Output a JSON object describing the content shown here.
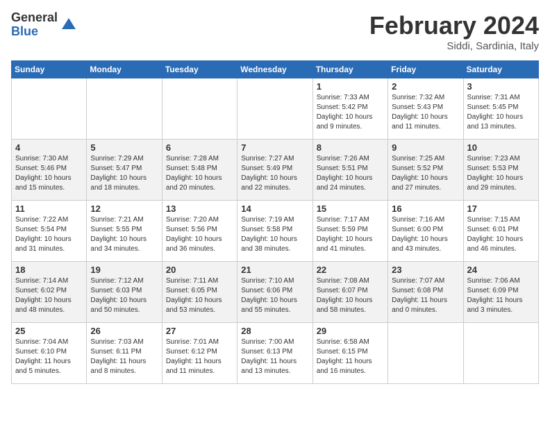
{
  "header": {
    "logo_general": "General",
    "logo_blue": "Blue",
    "title": "February 2024",
    "subtitle": "Siddi, Sardinia, Italy"
  },
  "days_of_week": [
    "Sunday",
    "Monday",
    "Tuesday",
    "Wednesday",
    "Thursday",
    "Friday",
    "Saturday"
  ],
  "weeks": [
    {
      "days": [
        {
          "number": "",
          "info": ""
        },
        {
          "number": "",
          "info": ""
        },
        {
          "number": "",
          "info": ""
        },
        {
          "number": "",
          "info": ""
        },
        {
          "number": "1",
          "info": "Sunrise: 7:33 AM\nSunset: 5:42 PM\nDaylight: 10 hours\nand 9 minutes."
        },
        {
          "number": "2",
          "info": "Sunrise: 7:32 AM\nSunset: 5:43 PM\nDaylight: 10 hours\nand 11 minutes."
        },
        {
          "number": "3",
          "info": "Sunrise: 7:31 AM\nSunset: 5:45 PM\nDaylight: 10 hours\nand 13 minutes."
        }
      ]
    },
    {
      "days": [
        {
          "number": "4",
          "info": "Sunrise: 7:30 AM\nSunset: 5:46 PM\nDaylight: 10 hours\nand 15 minutes."
        },
        {
          "number": "5",
          "info": "Sunrise: 7:29 AM\nSunset: 5:47 PM\nDaylight: 10 hours\nand 18 minutes."
        },
        {
          "number": "6",
          "info": "Sunrise: 7:28 AM\nSunset: 5:48 PM\nDaylight: 10 hours\nand 20 minutes."
        },
        {
          "number": "7",
          "info": "Sunrise: 7:27 AM\nSunset: 5:49 PM\nDaylight: 10 hours\nand 22 minutes."
        },
        {
          "number": "8",
          "info": "Sunrise: 7:26 AM\nSunset: 5:51 PM\nDaylight: 10 hours\nand 24 minutes."
        },
        {
          "number": "9",
          "info": "Sunrise: 7:25 AM\nSunset: 5:52 PM\nDaylight: 10 hours\nand 27 minutes."
        },
        {
          "number": "10",
          "info": "Sunrise: 7:23 AM\nSunset: 5:53 PM\nDaylight: 10 hours\nand 29 minutes."
        }
      ]
    },
    {
      "days": [
        {
          "number": "11",
          "info": "Sunrise: 7:22 AM\nSunset: 5:54 PM\nDaylight: 10 hours\nand 31 minutes."
        },
        {
          "number": "12",
          "info": "Sunrise: 7:21 AM\nSunset: 5:55 PM\nDaylight: 10 hours\nand 34 minutes."
        },
        {
          "number": "13",
          "info": "Sunrise: 7:20 AM\nSunset: 5:56 PM\nDaylight: 10 hours\nand 36 minutes."
        },
        {
          "number": "14",
          "info": "Sunrise: 7:19 AM\nSunset: 5:58 PM\nDaylight: 10 hours\nand 38 minutes."
        },
        {
          "number": "15",
          "info": "Sunrise: 7:17 AM\nSunset: 5:59 PM\nDaylight: 10 hours\nand 41 minutes."
        },
        {
          "number": "16",
          "info": "Sunrise: 7:16 AM\nSunset: 6:00 PM\nDaylight: 10 hours\nand 43 minutes."
        },
        {
          "number": "17",
          "info": "Sunrise: 7:15 AM\nSunset: 6:01 PM\nDaylight: 10 hours\nand 46 minutes."
        }
      ]
    },
    {
      "days": [
        {
          "number": "18",
          "info": "Sunrise: 7:14 AM\nSunset: 6:02 PM\nDaylight: 10 hours\nand 48 minutes."
        },
        {
          "number": "19",
          "info": "Sunrise: 7:12 AM\nSunset: 6:03 PM\nDaylight: 10 hours\nand 50 minutes."
        },
        {
          "number": "20",
          "info": "Sunrise: 7:11 AM\nSunset: 6:05 PM\nDaylight: 10 hours\nand 53 minutes."
        },
        {
          "number": "21",
          "info": "Sunrise: 7:10 AM\nSunset: 6:06 PM\nDaylight: 10 hours\nand 55 minutes."
        },
        {
          "number": "22",
          "info": "Sunrise: 7:08 AM\nSunset: 6:07 PM\nDaylight: 10 hours\nand 58 minutes."
        },
        {
          "number": "23",
          "info": "Sunrise: 7:07 AM\nSunset: 6:08 PM\nDaylight: 11 hours\nand 0 minutes."
        },
        {
          "number": "24",
          "info": "Sunrise: 7:06 AM\nSunset: 6:09 PM\nDaylight: 11 hours\nand 3 minutes."
        }
      ]
    },
    {
      "days": [
        {
          "number": "25",
          "info": "Sunrise: 7:04 AM\nSunset: 6:10 PM\nDaylight: 11 hours\nand 5 minutes."
        },
        {
          "number": "26",
          "info": "Sunrise: 7:03 AM\nSunset: 6:11 PM\nDaylight: 11 hours\nand 8 minutes."
        },
        {
          "number": "27",
          "info": "Sunrise: 7:01 AM\nSunset: 6:12 PM\nDaylight: 11 hours\nand 11 minutes."
        },
        {
          "number": "28",
          "info": "Sunrise: 7:00 AM\nSunset: 6:13 PM\nDaylight: 11 hours\nand 13 minutes."
        },
        {
          "number": "29",
          "info": "Sunrise: 6:58 AM\nSunset: 6:15 PM\nDaylight: 11 hours\nand 16 minutes."
        },
        {
          "number": "",
          "info": ""
        },
        {
          "number": "",
          "info": ""
        }
      ]
    }
  ]
}
